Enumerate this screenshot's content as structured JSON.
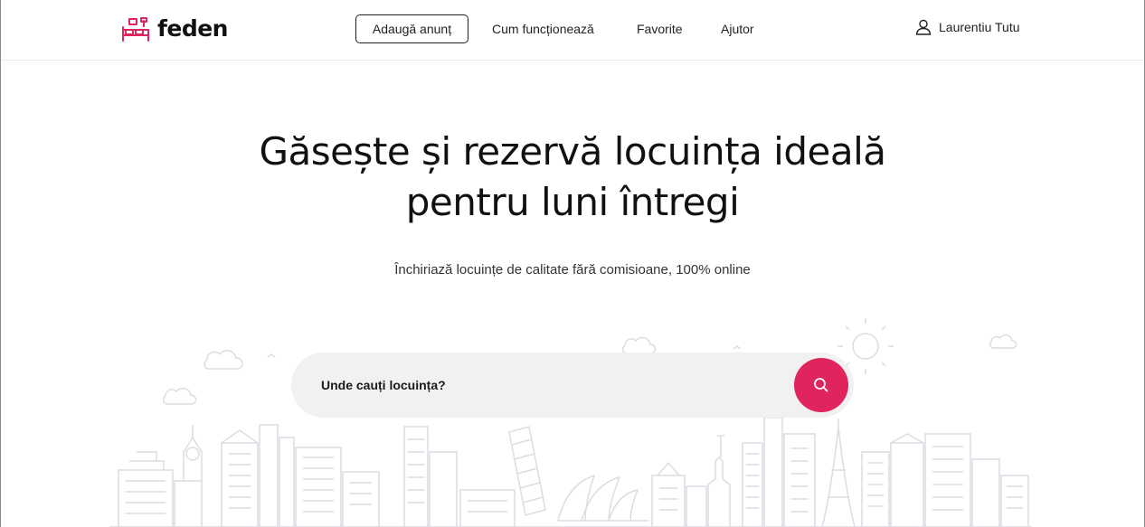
{
  "brand": {
    "name": "feden",
    "accent": "#e0245e"
  },
  "header": {
    "add_listing_label": "Adaugă anunț",
    "nav": [
      {
        "label": "Cum funcționează"
      },
      {
        "label": "Favorite"
      },
      {
        "label": "Ajutor"
      }
    ],
    "user": {
      "icon": "user-icon",
      "name": "Laurentiu Tutu"
    }
  },
  "hero": {
    "headline_line1": "Găsește și rezervă locuința ideală",
    "headline_line2": "pentru luni întregi",
    "subtitle": "Închiriază locuințe de calitate fără comisioane, 100% online"
  },
  "search": {
    "placeholder": "Unde cauți locuința?",
    "value": "",
    "button_icon": "search-icon"
  },
  "illustration": {
    "name": "city-skyline-illustration",
    "color": "#d9dee3"
  }
}
